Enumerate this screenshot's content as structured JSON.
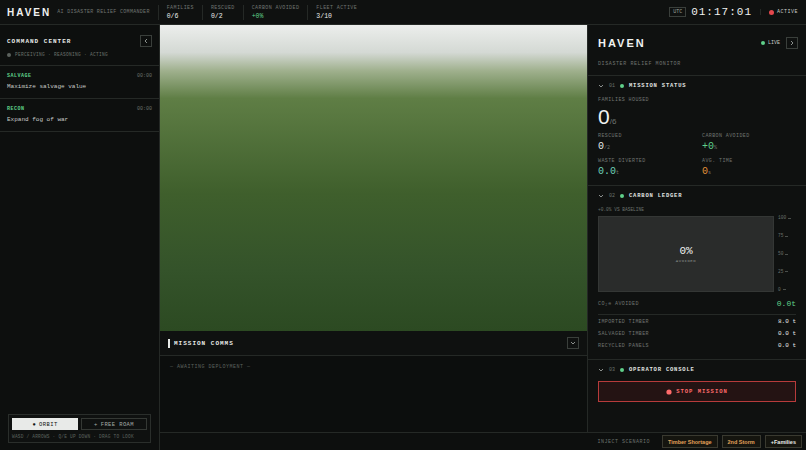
{
  "header": {
    "logo": "HAVEN",
    "subtitle": "AI DISASTER RELIEF COMMANDER",
    "stats": [
      {
        "label": "FAMILIES",
        "value": "0/6",
        "color": "#e8ebe9"
      },
      {
        "label": "RESCUED",
        "value": "0/2",
        "color": "#e8ebe9"
      },
      {
        "label": "CARBON AVOIDED",
        "value": "+0%",
        "color": "#5fd08a"
      },
      {
        "label": "FLEET ACTIVE",
        "value": "3/10",
        "color": "#e8ebe9"
      }
    ],
    "clock": {
      "zone": "UTC",
      "time": "01:17:01"
    },
    "status": {
      "label": "ACTIVE",
      "color": "#e5484d"
    }
  },
  "command_center": {
    "title": "COMMAND CENTER",
    "phases": "PERCEIVING · REASONING · ACTING",
    "tasks": [
      {
        "tag": "SALVAGE",
        "time": "00:00",
        "text": "Maximize salvage value"
      },
      {
        "tag": "RECON",
        "time": "00:00",
        "text": "Expand fog of war"
      }
    ]
  },
  "camera": {
    "modes": [
      {
        "label": "ORBIT",
        "icon": "●",
        "selected": true
      },
      {
        "label": "FREE ROAM",
        "icon": "+",
        "selected": false
      }
    ],
    "hint": "WASD / ARROWS · Q/E UP DOWN · DRAG TO LOOK"
  },
  "comms": {
    "title": "MISSION COMMS",
    "placeholder": "— AWAITING DEPLOYMENT —"
  },
  "monitor": {
    "title": "HAVEN",
    "subtitle": "DISASTER RELIEF MONITOR",
    "live": "LIVE",
    "mission_status": {
      "number": "01",
      "title": "MISSION STATUS",
      "expanded": true,
      "headline": {
        "label": "FAMILIES HOUSED",
        "value": "0",
        "unit": "/6"
      },
      "metrics": [
        {
          "label": "RESCUED",
          "value": "0",
          "unit": "/2",
          "color": "#e8ebe9"
        },
        {
          "label": "CARBON AVOIDED",
          "value": "+0",
          "unit": "%",
          "color": "#5fd08a"
        },
        {
          "label": "WASTE DIVERTED",
          "value": "0.0",
          "unit": "t",
          "color": "#6fd3b8"
        },
        {
          "label": "AVG. TIME",
          "value": "0",
          "unit": "s",
          "color": "#e3913a"
        }
      ]
    },
    "carbon_ledger": {
      "number": "02",
      "title": "CARBON LEDGER",
      "expanded": true,
      "baseline": "+0.0% VS BASELINE",
      "chart": {
        "value": "0%",
        "caption": "AVOIDED",
        "ticks": [
          "100",
          "75",
          "50",
          "25",
          "0"
        ]
      },
      "total": {
        "label": "CO₂e AVOIDED",
        "value": "0.0t"
      },
      "rows": [
        {
          "label": "IMPORTED TIMBER",
          "value": "8.0 t"
        },
        {
          "label": "SALVAGED TIMBER",
          "value": "0.0 t"
        },
        {
          "label": "RECYCLED PANELS",
          "value": "0.0 t"
        }
      ]
    },
    "operator_console": {
      "number": "03",
      "title": "OPERATOR CONSOLE",
      "expanded": true,
      "button": "STOP MISSION"
    }
  },
  "inject": {
    "label": "INJECT SCENARIO",
    "buttons": [
      {
        "label": "Timber Shortage",
        "color": "#e3a15a"
      },
      {
        "label": "2nd Storm",
        "color": "#e3a15a"
      },
      {
        "label": "+Families",
        "color": "#e8ebe9"
      }
    ]
  }
}
